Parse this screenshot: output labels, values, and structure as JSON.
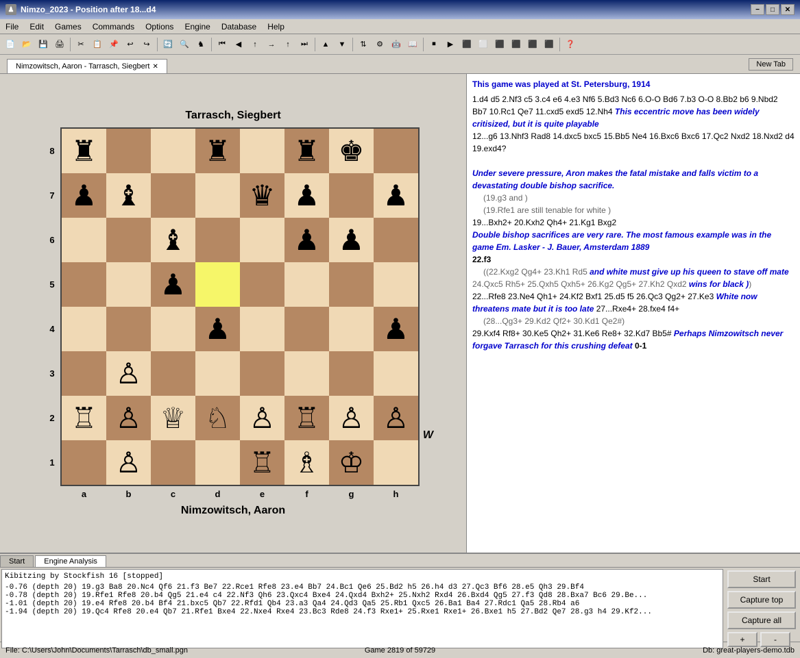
{
  "titlebar": {
    "icon": "♟",
    "title": "Nimzo_2023  -  Position after 18...d4",
    "min": "−",
    "max": "□",
    "close": "✕"
  },
  "menu": {
    "items": [
      "File",
      "Edit",
      "Games",
      "Commands",
      "Options",
      "Engine",
      "Database",
      "Help"
    ]
  },
  "tabbar": {
    "tab_label": "Nimzowitsch, Aaron - Tarrasch, Siegbert",
    "new_tab": "New Tab"
  },
  "board": {
    "player_top": "Tarrasch, Siegbert",
    "player_bottom": "Nimzowitsch, Aaron",
    "rank_labels": [
      "8",
      "7",
      "6",
      "5",
      "4",
      "3",
      "2",
      "1"
    ],
    "file_labels": [
      "a",
      "b",
      "c",
      "d",
      "e",
      "f",
      "g",
      "h"
    ],
    "w_indicator": "W"
  },
  "game_text": {
    "intro": "This game was played at St. Petersburg, 1914",
    "moves1": "1.d4 d5 2.Nf3 c5 3.c4 e6 4.e3 Nf6 5.Bd3 Nc6 6.O-O Bd6 7.b3 O-O 8.Bb2 b6 9.Nbd2 Bb7 10.Rc1 Qe7 11.cxd5 exd5 12.Nh4",
    "comment1": " This eccentric move has been widely critisized, but it is quite playable",
    "moves2": " 12...g6 13.Nhf3 Rad8 14.dxc5 bxc5 15.Bb5 Ne4 16.Bxc6 Bxc6 17.Qc2 Nxd2 18.Nxd2 d4 19.exd4?",
    "comment2": "Under severe pressure,  Aron makes the fatal mistake and falls victim to a devastating double bishop sacrifice.",
    "var1": "(19.g3  and )",
    "var2": "(19.Rfe1  are still tenable for white )",
    "moves3": "19...Bxh2+ 20.Kxh2 Qh4+ 21.Kg1 Bxg2",
    "comment3": "Double bishop sacrifices are very rare. The most famous example was in the game Em. Lasker - J. Bauer, Amsterdam 1889",
    "moves4": "22.f3",
    "var3": "(22.Kxg2 Qg4+ 23.Kh1 Rd5",
    "comment4": " and white must give up his queen to stave off mate",
    "var4": "24.Qxc5 Rh5+ 25.Qxh5 Qxh5+ 26.Kg2 Qg5+ 27.Kh2 Qxd2",
    "comment5": " wins for black )",
    "moves5": "22...Rfe8 23.Ne4 Qh1+ 24.Kf2 Bxf1 25.d5 f5 26.Qc3 Qg2+ 27.Ke3",
    "comment6": " White now threatens mate but it is too late",
    "moves6": " 27...Rxe4+ 28.fxe4 f4+",
    "var5": "(28...Qg3+ 29.Kd2 Qf2+ 30.Kd1 Qe2#)",
    "moves7": "29.Kxf4 Rf8+ 30.Ke5 Qh2+ 31.Ke6 Re8+ 32.Kd7 Bb5#",
    "comment7": " Perhaps Nimzowitsch never forgave Tarrasch for this crushing defeat",
    "result": " 0-1"
  },
  "engine": {
    "tabs": [
      "Start",
      "Engine Analysis"
    ],
    "active_tab": "Engine Analysis",
    "kibitzing": "Kibitzing by Stockfish 16 [stopped]",
    "lines": [
      "-0.76 (depth 20) 19.g3 Ba8 20.Nc4 Qf6 21.f3 Be7 22.Rce1 Rfe8 23.e4 Bb7 24.Bc1 Qe6 25.Bd2 h5 26.h4 d3 27.Qc3 Bf6 28.e5 Qh3 29.Bf4",
      "-0.78 (depth 20) 19.Rfe1 Rfe8 20.b4 Qg5 21.e4 c4 22.Nf3 Qh6 23.Qxc4 Bxe4 24.Qxd4 Bxh2+ 25.Nxh2 Rxd4 26.Bxd4 Qg5 27.f3 Qd8 28.Bxa7 Bc6 29.Be...",
      "-1.01 (depth 20) 19.e4 Rfe8 20.b4 Bf4 21.bxc5 Qb7 22.Rfd1 Qb4 23.a3 Qa4 24.Qd3 Qa5 25.Rb1 Qxc5 26.Ba1 Ba4 27.Rdc1 Qa5 28.Rb4 a6",
      "-1.94 (depth 20) 19.Qc4 Rfe8 20.e4 Qb7 21.Rfe1 Bxe4 22.Nxe4 Rxe4 23.Bc3 Rde8 24.f3 Rxe1+ 25.Rxe1 Rxe1+ 26.Bxe1 h5 27.Bd2 Qe7 28.g3 h4 29.Kf2..."
    ],
    "buttons": {
      "start": "Start",
      "capture_top": "Capture top",
      "capture_all": "Capture all",
      "plus": "+",
      "minus": "-"
    }
  },
  "statusbar": {
    "file": "File: C:\\Users\\John\\Documents\\Tarrasch\\db_small.pgn",
    "game": "Game 2819 of 59729",
    "db": "Db: great-players-demo.tdb"
  }
}
